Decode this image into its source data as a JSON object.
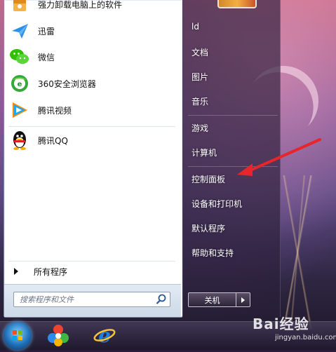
{
  "programs": [
    {
      "label": "强力卸载电脑上的软件",
      "icon": "uninstall-box-icon"
    },
    {
      "label": "迅雷",
      "icon": "xunlei-bird-icon"
    },
    {
      "label": "微信",
      "icon": "wechat-icon"
    },
    {
      "label": "360安全浏览器",
      "icon": "360-browser-icon"
    },
    {
      "label": "腾讯视频",
      "icon": "tencent-video-icon"
    },
    {
      "label": "腾讯QQ",
      "icon": "qq-penguin-icon"
    }
  ],
  "all_programs": "所有程序",
  "search": {
    "placeholder": "搜索程序和文件"
  },
  "right_menu": [
    "ld",
    "文档",
    "图片",
    "音乐",
    "游戏",
    "计算机",
    "控制面板",
    "设备和打印机",
    "默认程序",
    "帮助和支持"
  ],
  "shutdown": {
    "label": "关机"
  },
  "watermark": {
    "brand": "Bai经验",
    "url": "jingyan.baidu.com"
  },
  "colors": {
    "annotation_arrow": "#e8252a"
  }
}
